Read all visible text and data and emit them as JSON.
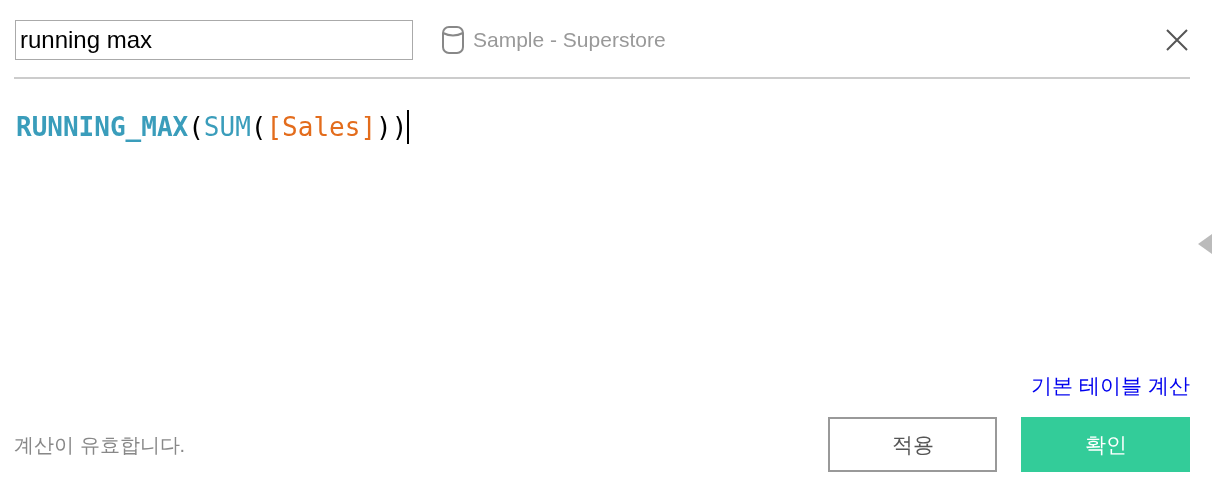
{
  "name_field": {
    "value": "running max"
  },
  "data_source": {
    "label": "Sample - Superstore"
  },
  "formula": [
    {
      "text": "RUNNING_MAX",
      "kind": "keyword"
    },
    {
      "text": "(",
      "kind": "punct"
    },
    {
      "text": "SUM",
      "kind": "function"
    },
    {
      "text": "(",
      "kind": "punct"
    },
    {
      "text": "[Sales]",
      "kind": "field"
    },
    {
      "text": ")",
      "kind": "punct"
    },
    {
      "text": ")",
      "kind": "punct"
    }
  ],
  "default_table_calc_link": "기본 테이블 계산",
  "status": "계산이 유효합니다.",
  "buttons": [
    {
      "label": "적용",
      "kind": "secondary"
    },
    {
      "label": "확인",
      "kind": "primary"
    }
  ]
}
